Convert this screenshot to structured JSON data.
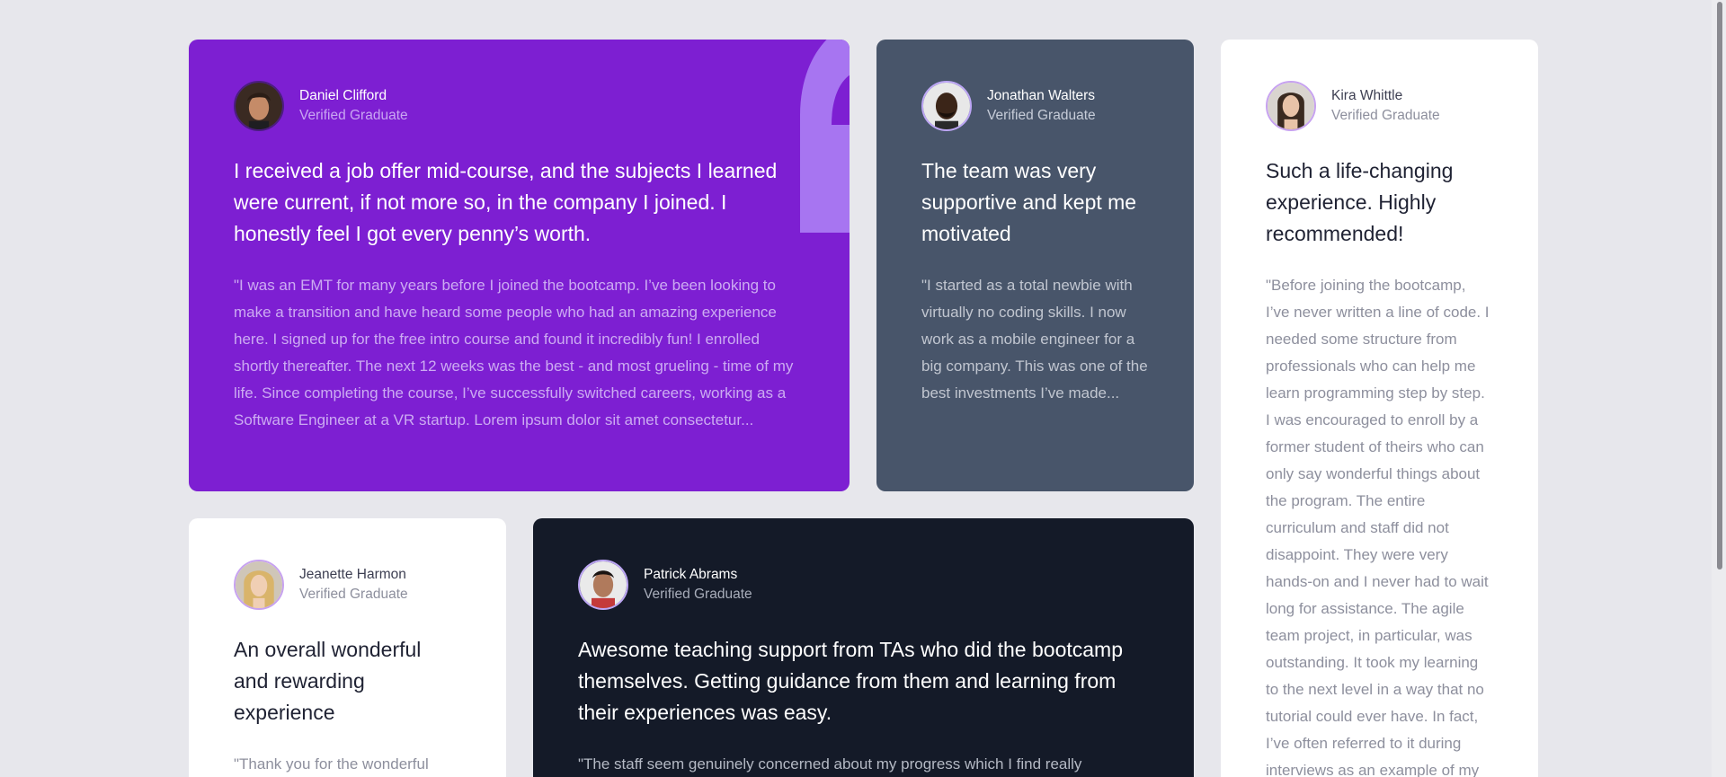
{
  "testimonials": {
    "daniel": {
      "name": "Daniel Clifford",
      "role": "Verified Graduate",
      "title": "I received a job offer mid-course, and the subjects I learned were current, if not more so, in the company I joined. I honestly feel I got every penny’s worth.",
      "body": "\"I was an EMT for many years before I joined the bootcamp. I’ve been looking to make a transition and have heard some people who had an amazing experience here. I signed up for the free intro course and found it incredibly fun! I enrolled shortly thereafter. The next 12 weeks was the best - and most grueling - time of my life. Since completing the course, I’ve successfully switched careers, working as a Software Engineer at a VR startup. Lorem ipsum dolor sit amet consectetur...",
      "bg_color": "#7d1fd2"
    },
    "jonathan": {
      "name": "Jonathan Walters",
      "role": "Verified Graduate",
      "title": "The team was very supportive and kept me motivated",
      "body": "\"I started as a total newbie with virtually no coding skills. I now work as a mobile engineer for a big company. This was one of the best investments I’ve made...",
      "bg_color": "#48556a"
    },
    "kira": {
      "name": "Kira Whittle",
      "role": "Verified Graduate",
      "title": "Such a life-changing experience. Highly recommended!",
      "body": "\"Before joining the bootcamp, I’ve never written a line of code. I needed some structure from professionals who can help me learn programming step by step. I was encouraged to enroll by a former student of theirs who can only say wonderful things about the program. The entire curriculum and staff did not disappoint. They were very hands-on and I never had to wait long for assistance. The agile team project, in particular, was outstanding. It took my learning to the next level in a way that no tutorial could ever have. In fact, I’ve often referred to it during interviews as an example of my",
      "bg_color": "#ffffff"
    },
    "jeanette": {
      "name": "Jeanette Harmon",
      "role": "Verified Graduate",
      "title": "An overall wonderful and rewarding experience",
      "body": "\"Thank you for the wonderful experience! I now have a job I",
      "bg_color": "#ffffff"
    },
    "patrick": {
      "name": "Patrick Abrams",
      "role": "Verified Graduate",
      "title": "Awesome teaching support from TAs who did the bootcamp themselves. Getting guidance from them and learning from their experiences was easy.",
      "body": "\"The staff seem genuinely concerned about my progress which I find really",
      "bg_color": "#141a28"
    }
  },
  "icons": {
    "quote": "quotation-mark-icon",
    "avatar": "avatar-photo"
  },
  "colors": {
    "page_bg": "#e7e7ec",
    "quote_mark": "#a775f1"
  }
}
